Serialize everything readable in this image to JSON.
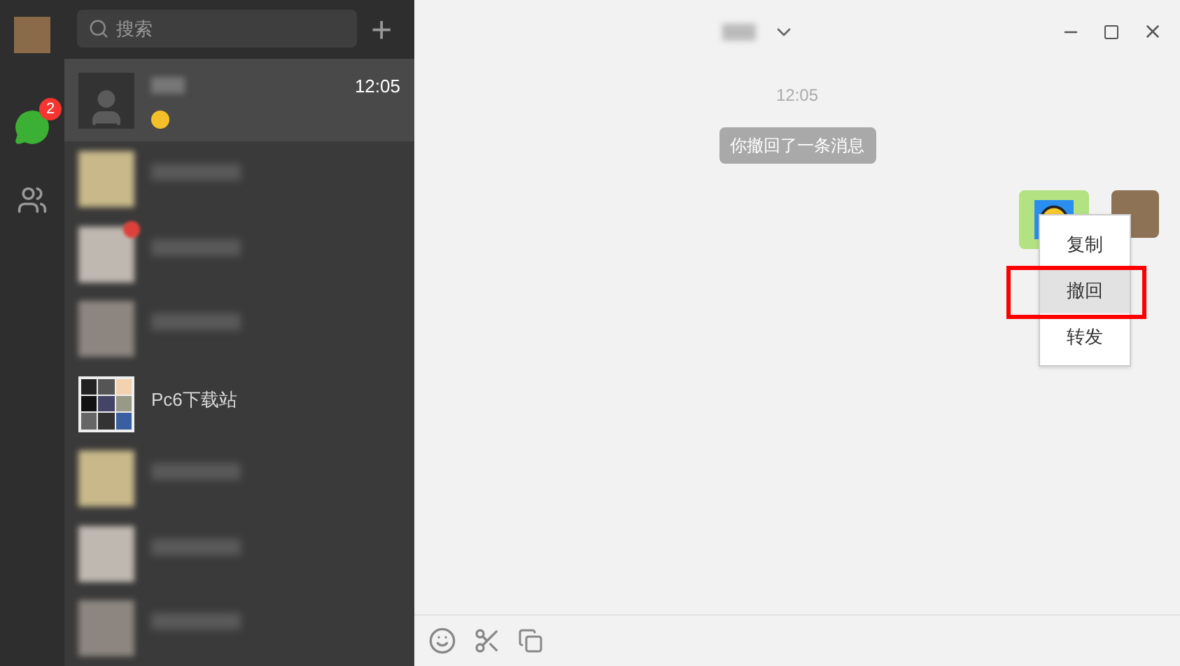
{
  "nav": {
    "chat_badge": "2"
  },
  "search": {
    "placeholder": "搜索",
    "add": "+"
  },
  "chats": [
    {
      "kind": "contact",
      "selected": true,
      "time": "12:05"
    },
    {
      "kind": "blurred",
      "selected": false,
      "unread": false
    },
    {
      "kind": "blurred",
      "selected": false,
      "unread": true
    },
    {
      "kind": "blurred",
      "selected": false,
      "unread": false
    },
    {
      "kind": "contact",
      "selected": false,
      "name": "Pc6下载站"
    },
    {
      "kind": "blurred",
      "selected": false,
      "unread": false
    },
    {
      "kind": "blurred",
      "selected": false,
      "unread": false
    },
    {
      "kind": "blurred",
      "selected": false,
      "unread": false
    }
  ],
  "chat": {
    "time": "12:05",
    "notice": "你撤回了一条消息"
  },
  "menu": [
    {
      "label": "复制",
      "selected": false
    },
    {
      "label": "撤回",
      "selected": true
    },
    {
      "label": "转发",
      "selected": false
    }
  ]
}
